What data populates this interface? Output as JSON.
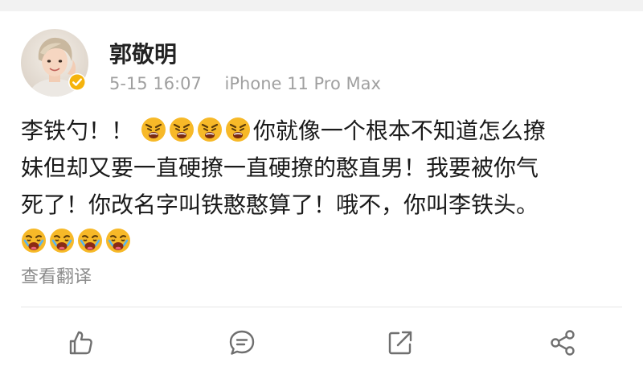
{
  "post": {
    "author": "郭敬明",
    "time": "5-15 16:07",
    "device": "iPhone 11 Pro Max",
    "body": {
      "line1_a": "李铁勺！！",
      "line1_b": "你就像一个根本不知道怎么撩",
      "line2": "妹但却又要一直硬撩一直硬撩的憨直男！我要被你气",
      "line3": "死了！你改名字叫铁憨憨算了！哦不，你叫李铁头。"
    },
    "translate_label": "查看翻译"
  },
  "icons": {
    "verified": "verified-badge-icon",
    "emoji_row1": "angry-face-icon",
    "emoji_row2": "crying-face-icon",
    "like": "thumbs-up-icon",
    "comment": "comment-icon",
    "repost": "repost-icon",
    "share": "share-icon"
  },
  "colors": {
    "verified_badge": "#f5b30c",
    "meta_text": "#a0a0a0",
    "translate_text": "#8c8c8c",
    "action_icon": "#6f6f6f"
  }
}
